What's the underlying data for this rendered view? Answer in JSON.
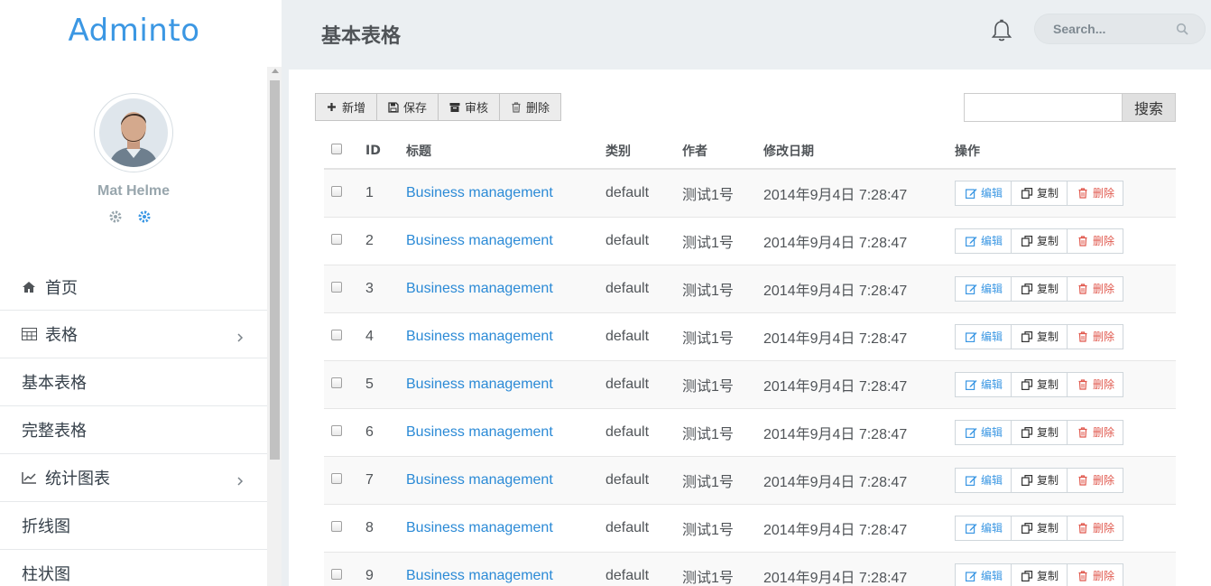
{
  "app": {
    "logo": "Adminto"
  },
  "user": {
    "name": "Mat Helme"
  },
  "menu": {
    "items": [
      {
        "label": "首页",
        "icon": "home-icon"
      },
      {
        "label": "表格",
        "icon": "table-icon",
        "has_submenu": true
      },
      {
        "label": "基本表格"
      },
      {
        "label": "完整表格"
      },
      {
        "label": "统计图表",
        "icon": "line-chart-icon",
        "has_submenu": true
      },
      {
        "label": "折线图"
      },
      {
        "label": "柱状图"
      }
    ]
  },
  "header": {
    "title": "基本表格",
    "search_placeholder": "Search..."
  },
  "toolbar": {
    "add": "新增",
    "save": "保存",
    "audit": "审核",
    "delete": "删除"
  },
  "table_search": {
    "button": "搜索"
  },
  "table": {
    "headers": {
      "id": "ID",
      "title": "标题",
      "category": "类别",
      "author": "作者",
      "modified": "修改日期",
      "actions": "操作"
    },
    "actions": {
      "edit": "编辑",
      "copy": "复制",
      "delete": "删除"
    },
    "rows": [
      {
        "id": "1",
        "title": "Business management",
        "category": "default",
        "author": "测试1号",
        "modified": "2014年9月4日 7:28:47"
      },
      {
        "id": "2",
        "title": "Business management",
        "category": "default",
        "author": "测试1号",
        "modified": "2014年9月4日 7:28:47"
      },
      {
        "id": "3",
        "title": "Business management",
        "category": "default",
        "author": "测试1号",
        "modified": "2014年9月4日 7:28:47"
      },
      {
        "id": "4",
        "title": "Business management",
        "category": "default",
        "author": "测试1号",
        "modified": "2014年9月4日 7:28:47"
      },
      {
        "id": "5",
        "title": "Business management",
        "category": "default",
        "author": "测试1号",
        "modified": "2014年9月4日 7:28:47"
      },
      {
        "id": "6",
        "title": "Business management",
        "category": "default",
        "author": "测试1号",
        "modified": "2014年9月4日 7:28:47"
      },
      {
        "id": "7",
        "title": "Business management",
        "category": "default",
        "author": "测试1号",
        "modified": "2014年9月4日 7:28:47"
      },
      {
        "id": "8",
        "title": "Business management",
        "category": "default",
        "author": "测试1号",
        "modified": "2014年9月4日 7:28:47"
      },
      {
        "id": "9",
        "title": "Business management",
        "category": "default",
        "author": "测试1号",
        "modified": "2014年9月4日 7:28:47"
      }
    ]
  },
  "colors": {
    "brand": "#3b97e3",
    "link": "#2b8ad6",
    "danger": "#e0584d",
    "background": "#ebeff2"
  }
}
